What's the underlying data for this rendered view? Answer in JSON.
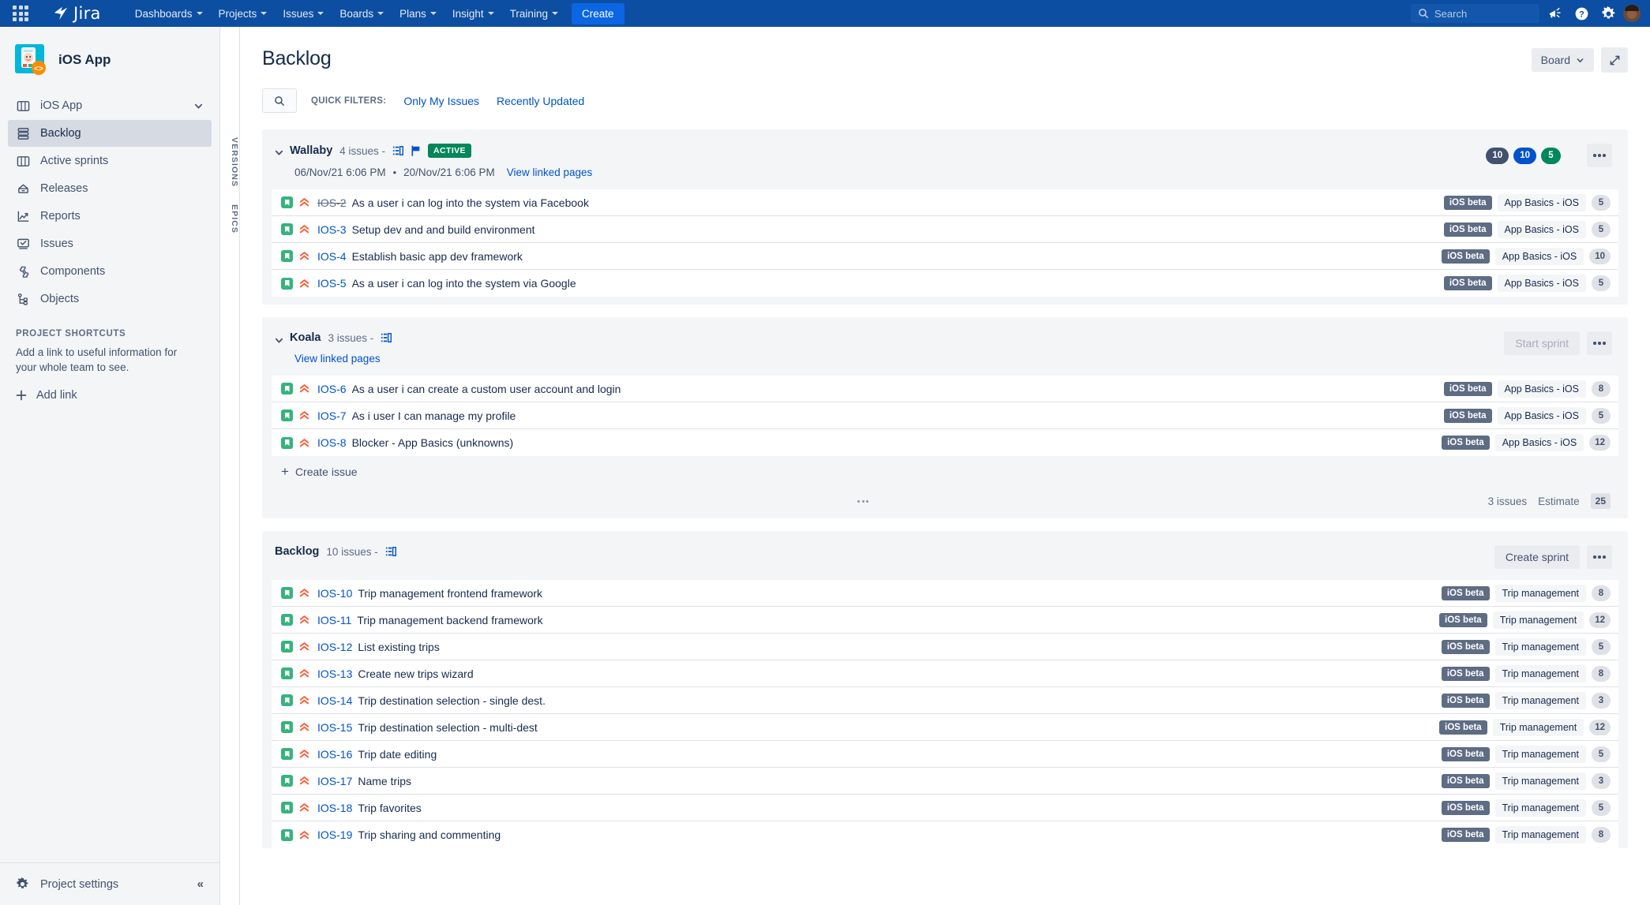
{
  "topnav": {
    "app_switcher_icon": "grid-apps-icon",
    "brand": "Jira",
    "items": [
      {
        "label": "Dashboards",
        "has_caret": true
      },
      {
        "label": "Projects",
        "has_caret": true
      },
      {
        "label": "Issues",
        "has_caret": true
      },
      {
        "label": "Boards",
        "has_caret": true
      },
      {
        "label": "Plans",
        "has_caret": true
      },
      {
        "label": "Insight",
        "has_caret": true
      },
      {
        "label": "Training",
        "has_caret": true
      }
    ],
    "create_label": "Create",
    "search_placeholder": "Search",
    "right_icons": [
      "megaphone-icon",
      "help-icon",
      "gear-icon",
      "avatar"
    ]
  },
  "sidebar": {
    "project_name": "iOS App",
    "project_avatar_icon": "ios-app-project-avatar",
    "items": [
      {
        "label": "iOS App",
        "icon": "board-icon",
        "active": false,
        "has_chevron": true
      },
      {
        "label": "Backlog",
        "icon": "backlog-icon",
        "active": true
      },
      {
        "label": "Active sprints",
        "icon": "columns-icon",
        "active": false
      },
      {
        "label": "Releases",
        "icon": "releases-icon",
        "active": false
      },
      {
        "label": "Reports",
        "icon": "reports-icon",
        "active": false
      },
      {
        "label": "Issues",
        "icon": "issues-icon",
        "active": false
      },
      {
        "label": "Components",
        "icon": "components-icon",
        "active": false
      },
      {
        "label": "Objects",
        "icon": "objects-icon",
        "active": false
      }
    ],
    "shortcuts_title": "PROJECT SHORTCUTS",
    "shortcuts_desc": "Add a link to useful information for your whole team to see.",
    "add_link_label": "Add link",
    "project_settings_label": "Project settings",
    "collapse_icon": "double-chevron-left-icon"
  },
  "vertical_tabs": [
    {
      "label": "VERSIONS"
    },
    {
      "label": "EPICS"
    }
  ],
  "main": {
    "page_title": "Backlog",
    "board_button_label": "Board",
    "expand_icon": "expand-diagonal-icon",
    "quick_filters_label": "QUICK FILTERS:",
    "quick_filters": [
      {
        "label": "Only My Issues"
      },
      {
        "label": "Recently Updated"
      }
    ],
    "search_icon": "search-icon"
  },
  "sprints": [
    {
      "name": "Wallaby",
      "issue_count_label": "4 issues -",
      "status_badge": "ACTIVE",
      "start_date": "06/Nov/21 6:06 PM",
      "date_separator": "•",
      "end_date": "20/Nov/21 6:06 PM",
      "linked_pages_label": "View linked pages",
      "pills": [
        {
          "value": "10",
          "color": "#42526e"
        },
        {
          "value": "10",
          "color": "#0052cc"
        },
        {
          "value": "5",
          "color": "#00875a"
        }
      ],
      "action_button": null,
      "more_icon": "more-horizontal-icon",
      "issues": [
        {
          "key": "IOS-2",
          "summary": "As a user i can log into the system via Facebook",
          "done": true,
          "version": "iOS beta",
          "epic": "App Basics - iOS",
          "points": "5",
          "type_icon": "story-icon",
          "priority_icon": "highest-priority-icon"
        },
        {
          "key": "IOS-3",
          "summary": "Setup dev and and build environment",
          "done": false,
          "version": "iOS beta",
          "epic": "App Basics - iOS",
          "points": "5",
          "type_icon": "story-icon",
          "priority_icon": "highest-priority-icon"
        },
        {
          "key": "IOS-4",
          "summary": "Establish basic app dev framework",
          "done": false,
          "version": "iOS beta",
          "epic": "App Basics - iOS",
          "points": "10",
          "type_icon": "story-icon",
          "priority_icon": "highest-priority-icon"
        },
        {
          "key": "IOS-5",
          "summary": "As a user i can log into the system via Google",
          "done": false,
          "version": "iOS beta",
          "epic": "App Basics - iOS",
          "points": "5",
          "type_icon": "story-icon",
          "priority_icon": "highest-priority-icon"
        }
      ],
      "footer": null
    },
    {
      "name": "Koala",
      "issue_count_label": "3 issues -",
      "status_badge": null,
      "start_date": null,
      "date_separator": null,
      "end_date": null,
      "linked_pages_label": "View linked pages",
      "pills": [],
      "action_button": "Start sprint",
      "more_icon": "more-horizontal-icon",
      "issues": [
        {
          "key": "IOS-6",
          "summary": "As a user i can create a custom user account and login",
          "done": false,
          "version": "iOS beta",
          "epic": "App Basics - iOS",
          "points": "8",
          "type_icon": "story-icon",
          "priority_icon": "highest-priority-icon"
        },
        {
          "key": "IOS-7",
          "summary": "As i user I can manage my profile",
          "done": false,
          "version": "iOS beta",
          "epic": "App Basics - iOS",
          "points": "5",
          "type_icon": "story-icon",
          "priority_icon": "highest-priority-icon"
        },
        {
          "key": "IOS-8",
          "summary": "Blocker - App Basics (unknowns)",
          "done": false,
          "version": "iOS beta",
          "epic": "App Basics - iOS",
          "points": "12",
          "type_icon": "story-icon",
          "priority_icon": "highest-priority-icon"
        }
      ],
      "create_issue_label": "Create issue",
      "footer": {
        "issues_text": "3 issues",
        "estimate_label": "Estimate",
        "estimate_value": "25"
      }
    },
    {
      "name": "Backlog",
      "issue_count_label": "10 issues -",
      "status_badge": null,
      "start_date": null,
      "date_separator": null,
      "end_date": null,
      "linked_pages_label": null,
      "pills": [],
      "action_button": "Create sprint",
      "more_icon": "more-horizontal-icon",
      "issues": [
        {
          "key": "IOS-10",
          "summary": "Trip management frontend framework",
          "done": false,
          "version": "iOS beta",
          "epic": "Trip management",
          "points": "8",
          "type_icon": "story-icon",
          "priority_icon": "highest-priority-icon"
        },
        {
          "key": "IOS-11",
          "summary": "Trip management backend framework",
          "done": false,
          "version": "iOS beta",
          "epic": "Trip management",
          "points": "12",
          "type_icon": "story-icon",
          "priority_icon": "highest-priority-icon"
        },
        {
          "key": "IOS-12",
          "summary": "List existing trips",
          "done": false,
          "version": "iOS beta",
          "epic": "Trip management",
          "points": "5",
          "type_icon": "story-icon",
          "priority_icon": "highest-priority-icon"
        },
        {
          "key": "IOS-13",
          "summary": "Create new trips wizard",
          "done": false,
          "version": "iOS beta",
          "epic": "Trip management",
          "points": "8",
          "type_icon": "story-icon",
          "priority_icon": "highest-priority-icon"
        },
        {
          "key": "IOS-14",
          "summary": "Trip destination selection - single dest.",
          "done": false,
          "version": "iOS beta",
          "epic": "Trip management",
          "points": "3",
          "type_icon": "story-icon",
          "priority_icon": "highest-priority-icon"
        },
        {
          "key": "IOS-15",
          "summary": "Trip destination selection - multi-dest",
          "done": false,
          "version": "iOS beta",
          "epic": "Trip management",
          "points": "12",
          "type_icon": "story-icon",
          "priority_icon": "highest-priority-icon"
        },
        {
          "key": "IOS-16",
          "summary": "Trip date editing",
          "done": false,
          "version": "iOS beta",
          "epic": "Trip management",
          "points": "5",
          "type_icon": "story-icon",
          "priority_icon": "highest-priority-icon"
        },
        {
          "key": "IOS-17",
          "summary": "Name trips",
          "done": false,
          "version": "iOS beta",
          "epic": "Trip management",
          "points": "3",
          "type_icon": "story-icon",
          "priority_icon": "highest-priority-icon"
        },
        {
          "key": "IOS-18",
          "summary": "Trip favorites",
          "done": false,
          "version": "iOS beta",
          "epic": "Trip management",
          "points": "5",
          "type_icon": "story-icon",
          "priority_icon": "highest-priority-icon"
        },
        {
          "key": "IOS-19",
          "summary": "Trip sharing and commenting",
          "done": false,
          "version": "iOS beta",
          "epic": "Trip management",
          "points": "8",
          "type_icon": "story-icon",
          "priority_icon": "highest-priority-icon"
        }
      ],
      "footer": null
    }
  ],
  "colors": {
    "nav_blue": "#0c4ea2",
    "link_blue": "#0052cc",
    "accent_blue": "#0b66e4",
    "active_green": "#00875a",
    "story_green": "#36b37e",
    "priority_red": "#ff5630",
    "text_dark": "#172b4d",
    "text_muted": "#5e6c84"
  }
}
